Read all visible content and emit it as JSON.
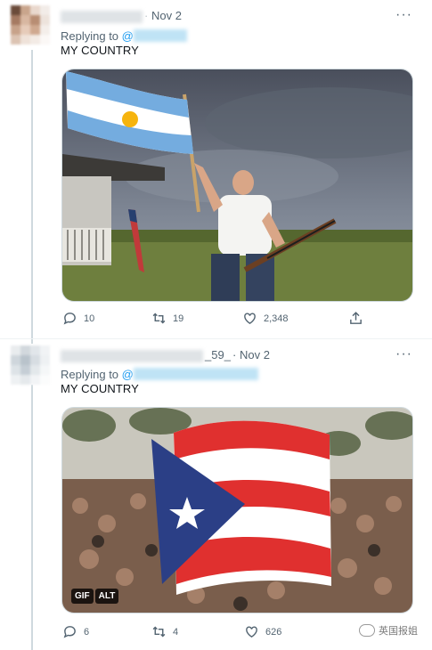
{
  "tweets": [
    {
      "handle_suffix": "",
      "date": "Nov 2",
      "replying_label": "Replying to",
      "replying_at": "@",
      "text": "MY COUNTRY",
      "stats": {
        "replies": "10",
        "retweets": "19",
        "likes": "2,348"
      },
      "media_badges": []
    },
    {
      "handle_suffix": "_59_",
      "date": "Nov 2",
      "replying_label": "Replying to",
      "replying_at": "@",
      "text": "MY COUNTRY",
      "stats": {
        "replies": "6",
        "retweets": "4",
        "likes": "626"
      },
      "media_badges": [
        "GIF",
        "ALT"
      ]
    }
  ],
  "more_glyph": "···",
  "date_separator": "·",
  "watermark": {
    "text": "英国报姐"
  },
  "icons": [
    "reply-icon",
    "retweet-icon",
    "like-icon",
    "share-icon",
    "more-options-icon"
  ],
  "colors": {
    "link": "#1d9bf0",
    "muted": "#536471",
    "text": "#0f1419",
    "line": "#cfd9de"
  }
}
